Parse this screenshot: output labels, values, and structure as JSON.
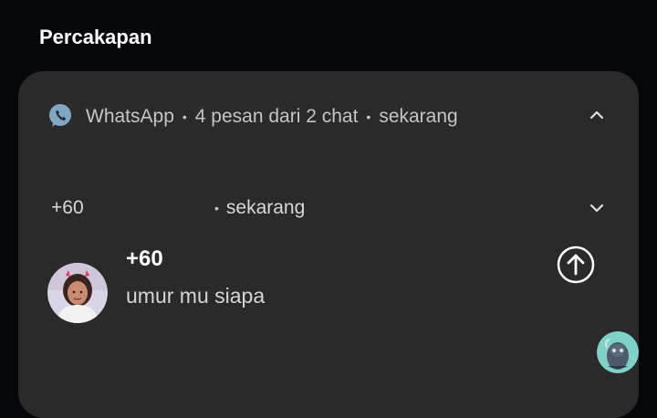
{
  "section": {
    "title": "Percakapan"
  },
  "notification": {
    "app_name": "WhatsApp",
    "summary": "4 pesan dari 2 chat",
    "time": "sekarang",
    "separator": "•",
    "collapse_icon": "chevron-up-icon"
  },
  "conversation": {
    "number": "+60",
    "time": "sekarang",
    "expand_icon": "chevron-down-icon",
    "sender": "+60",
    "message": "umur mu siapa",
    "reply_icon": "arrow-up-circle-icon"
  },
  "colors": {
    "background": "#05070b",
    "card": "#2a2a2a",
    "whatsapp_icon": "#7fa7c5",
    "bubble_avatar_bg": "#7fd1c8"
  }
}
